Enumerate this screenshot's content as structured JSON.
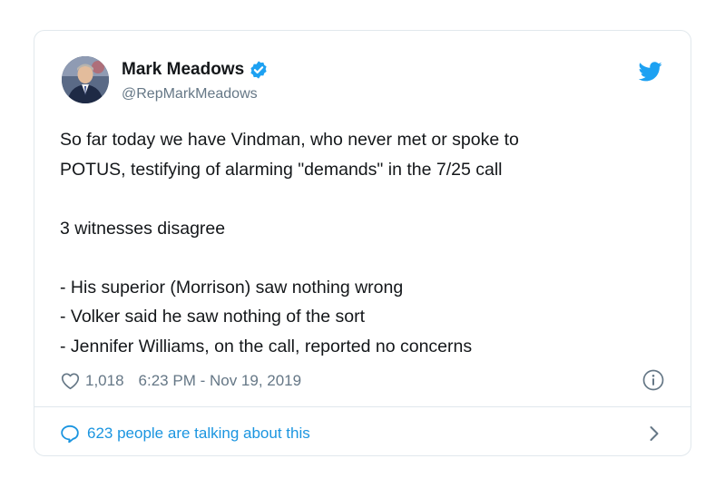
{
  "tweet": {
    "author": {
      "display_name": "Mark Meadows",
      "handle": "@RepMarkMeadows",
      "verified": true
    },
    "text": "So far today we have Vindman, who never met or spoke to\nPOTUS, testifying of alarming \"demands\" in the 7/25 call\n\n3 witnesses disagree\n\n- His superior (Morrison) saw nothing wrong\n- Volker said he saw nothing of the sort\n- Jennifer Williams, on the call, reported no concerns",
    "likes": "1,018",
    "timestamp": "6:23 PM - Nov 19, 2019",
    "conversation_link": "623 people are talking about this"
  },
  "icons": {
    "logo": "twitter-bird-icon",
    "verified": "verified-badge-icon",
    "like": "heart-icon",
    "info": "info-icon",
    "reply": "speech-bubble-icon",
    "more": "chevron-right-icon"
  },
  "colors": {
    "brand_blue": "#1da1f2",
    "link_blue": "#1b95e0",
    "text": "#14171a",
    "secondary_text": "#657786",
    "border": "#e1e8ed"
  }
}
